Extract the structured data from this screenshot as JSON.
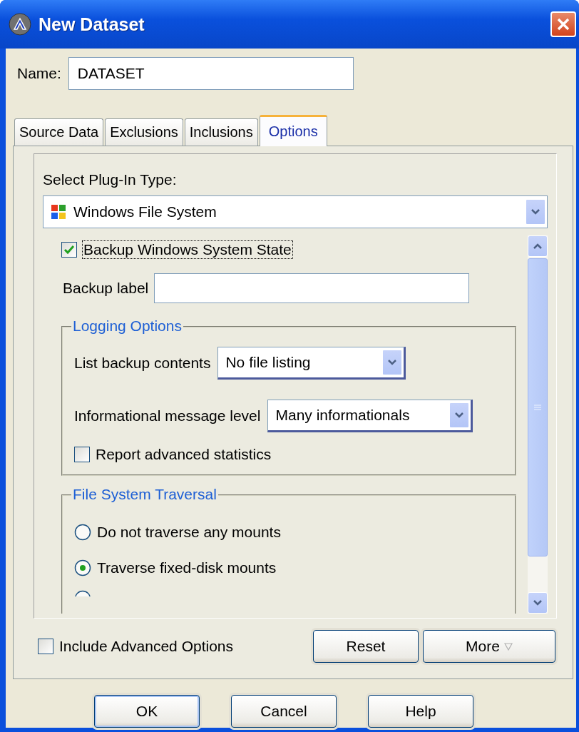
{
  "window": {
    "title": "New Dataset"
  },
  "name_field": {
    "label": "Name:",
    "value": "DATASET"
  },
  "tabs": [
    {
      "label": "Source Data",
      "selected": false
    },
    {
      "label": "Exclusions",
      "selected": false
    },
    {
      "label": "Inclusions",
      "selected": false
    },
    {
      "label": "Options",
      "selected": true
    }
  ],
  "plugin_type": {
    "label": "Select Plug-In Type:",
    "value": "Windows File System"
  },
  "backup_system_state": {
    "label": "Backup Windows System State",
    "checked": true,
    "focused": true
  },
  "backup_label": {
    "label": "Backup label"
  },
  "logging": {
    "title": "Logging Options",
    "list_contents": {
      "label": "List backup contents",
      "value": "No file listing"
    },
    "message_level": {
      "label": "Informational message level",
      "value": "Many informationals"
    },
    "report_stats": {
      "label": "Report advanced statistics",
      "checked": false
    }
  },
  "traversal": {
    "title": "File System Traversal",
    "radios": [
      {
        "label": "Do not traverse any mounts",
        "selected": false
      },
      {
        "label": "Traverse fixed-disk mounts",
        "selected": true
      },
      {
        "selected": false
      }
    ]
  },
  "include_advanced": {
    "label": "Include Advanced Options",
    "checked": false
  },
  "panel_buttons": [
    {
      "label": "Reset",
      "kind": "plain"
    },
    {
      "label": "More",
      "kind": "menu"
    }
  ],
  "dialog_buttons": [
    {
      "label": "OK",
      "default": true
    },
    {
      "label": "Cancel",
      "default": false
    },
    {
      "label": "Help",
      "default": false
    }
  ]
}
